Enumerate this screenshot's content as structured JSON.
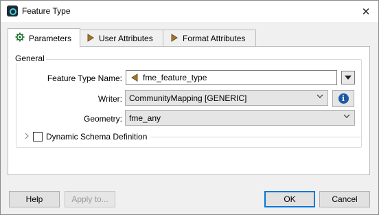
{
  "window": {
    "title": "Feature Type",
    "close_glyph": "✕"
  },
  "tabs": [
    {
      "label": "Parameters",
      "icon": "gear-icon",
      "active": true
    },
    {
      "label": "User Attributes",
      "icon": "attribute-arrow-icon",
      "active": false
    },
    {
      "label": "Format Attributes",
      "icon": "attribute-arrow-icon",
      "active": false
    }
  ],
  "general": {
    "title": "General",
    "feature_type_name": {
      "label": "Feature Type Name:",
      "value": "fme_feature_type"
    },
    "writer": {
      "label": "Writer:",
      "value": "CommunityMapping [GENERIC]"
    },
    "geometry": {
      "label": "Geometry:",
      "value": "fme_any"
    },
    "info_glyph": "i"
  },
  "dynamic_schema": {
    "label": "Dynamic Schema Definition",
    "checked": false
  },
  "buttons": {
    "help": "Help",
    "apply_to": "Apply to...",
    "ok": "OK",
    "cancel": "Cancel"
  },
  "colors": {
    "accent": "#0078d7",
    "info": "#1c5aa6",
    "feature_icon": "#a5772a"
  }
}
